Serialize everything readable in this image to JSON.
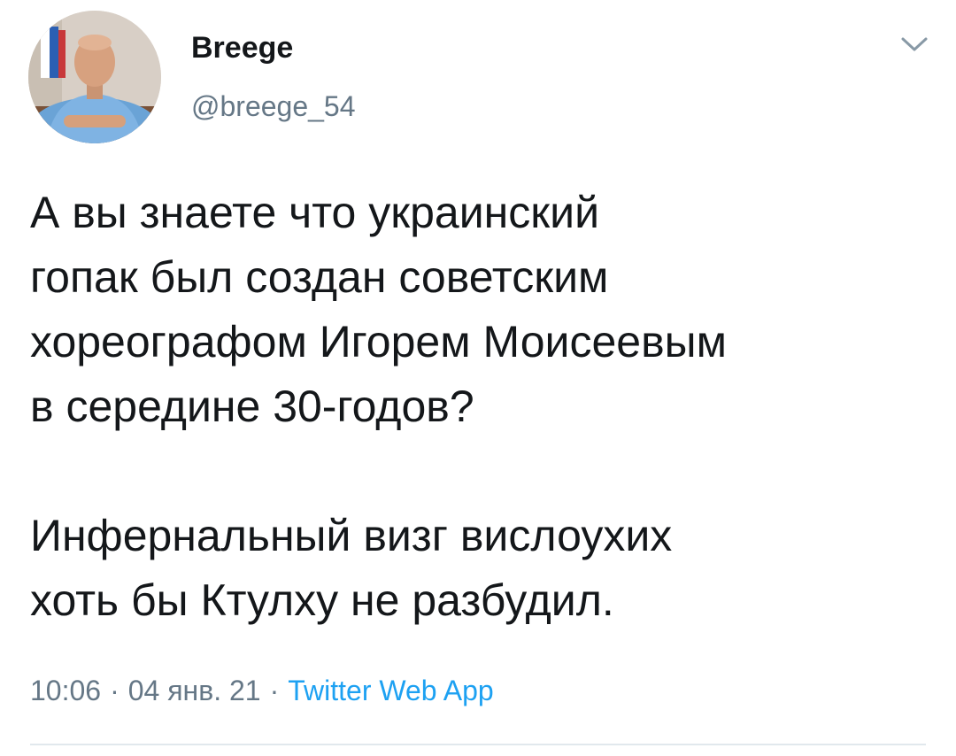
{
  "user": {
    "display_name": "Breege",
    "handle": "@breege_54",
    "avatar": "profile-photo"
  },
  "tweet": {
    "paragraph1": "А вы знаете что украинский\nгопак был создан советским\nхореографом Игорем Моисеевым\nв середине 30-годов?",
    "paragraph2": "Инфернальный визг вислоухих\nхоть бы Ктулху не разбудил.",
    "time": "10:06",
    "date": "04 янв. 21",
    "separator": "·",
    "source": "Twitter Web App"
  },
  "icons": {
    "menu": "chevron-down-icon"
  },
  "colors": {
    "text": "#14171a",
    "secondary": "#657786",
    "accent": "#1da1f2",
    "divider": "#e1e8ed"
  }
}
